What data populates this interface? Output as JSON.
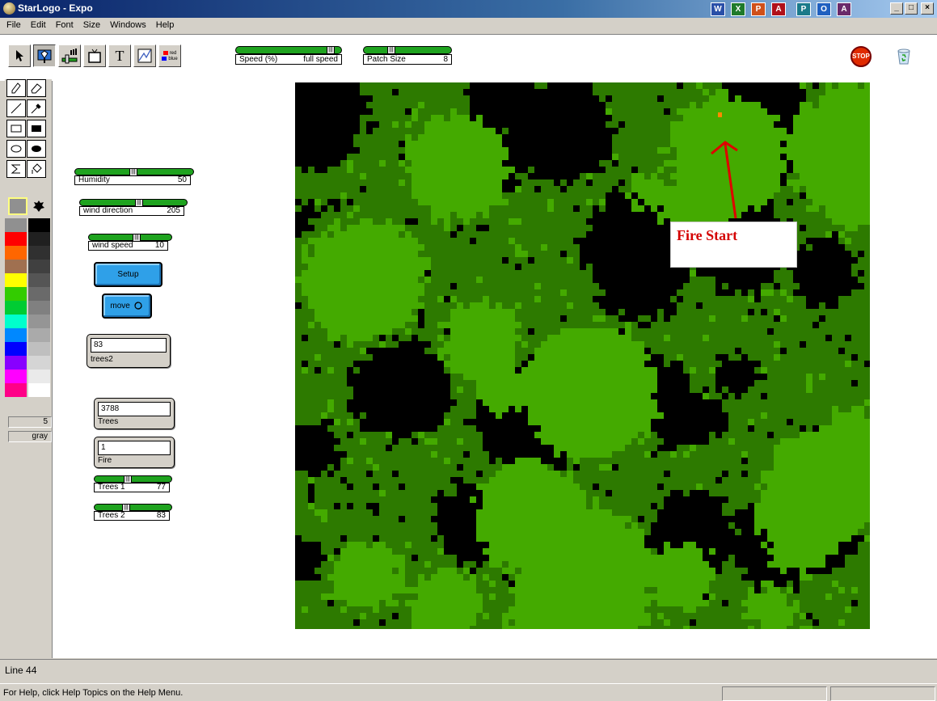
{
  "window": {
    "title": "StarLogo - Expo",
    "tray_icons": [
      "word-icon",
      "excel-icon",
      "powerpoint-icon",
      "acrobat-icon",
      "publisher-icon",
      "outlook-icon",
      "access-icon"
    ],
    "controls": [
      "_",
      "□",
      "×"
    ]
  },
  "menu": {
    "items": [
      "File",
      "Edit",
      "Font",
      "Size",
      "Windows",
      "Help"
    ]
  },
  "toolbar": {
    "buttons": [
      "select-tool-icon",
      "turtle-tool-icon",
      "slider-tool-icon",
      "monitor-tool-icon",
      "text-tool-icon",
      "plot-tool-icon",
      "color-key-tool-icon"
    ],
    "text_tool_label": "T",
    "color_key_labels": [
      "red",
      "blue"
    ],
    "speed": {
      "label": "Speed (%)",
      "value": "full speed",
      "level": 0.95
    },
    "patch_size": {
      "label": "Patch Size",
      "value": "8",
      "level": 0.3
    },
    "stop_label": "STOP"
  },
  "palette": {
    "tools": [
      "pencil-icon",
      "eraser-icon",
      "line-icon",
      "eyedropper-icon",
      "rectangle-outline-icon",
      "rectangle-filled-icon",
      "ellipse-outline-icon",
      "ellipse-filled-icon",
      "sigma-icon",
      "paint-bucket-icon"
    ],
    "colors_left": [
      "#909090",
      "#ff0000",
      "#ff6600",
      "#a07050",
      "#ffff00",
      "#33cc00",
      "#00cc33",
      "#00ffcc",
      "#0088ff",
      "#0000ff",
      "#8800ff",
      "#ff00ff",
      "#ff0088"
    ],
    "colors_right": [
      "#000000",
      "#202020",
      "#303030",
      "#404040",
      "#555555",
      "#6a6a6a",
      "#808080",
      "#959595",
      "#aaaaaa",
      "#bfbfbf",
      "#d5d5d5",
      "#eaeaea",
      "#ffffff"
    ],
    "selected_number": "5",
    "selected_color_name": "gray"
  },
  "sliders": [
    {
      "name": "humidity-slider",
      "label": "Humidity",
      "value": "50",
      "level": 0.5
    },
    {
      "name": "wind-direction-slider",
      "label": "wind direction",
      "value": "205",
      "level": 0.57
    },
    {
      "name": "wind-speed-slider",
      "label": "wind speed",
      "value": "10",
      "level": 0.6
    },
    {
      "name": "trees1-slider",
      "label": "Trees 1",
      "value": "77",
      "level": 0.43
    },
    {
      "name": "trees2-slider",
      "label": "Trees 2",
      "value": "83",
      "level": 0.41
    }
  ],
  "buttons": {
    "setup": "Setup",
    "move": "move"
  },
  "monitors": {
    "trees2": {
      "value": "83",
      "label": "trees2"
    },
    "trees": {
      "value": "3788",
      "label": "Trees"
    },
    "fire": {
      "value": "1",
      "label": "Fire"
    }
  },
  "annotation": {
    "text": "Fire Start",
    "color": "#d40000"
  },
  "world_colors": {
    "bright": "#44aa00",
    "dark": "#2d7a00",
    "empty": "#000000",
    "fire": "#ff8800"
  },
  "status": {
    "line": "Line 44",
    "help": "For Help, click Help Topics on the Help Menu."
  }
}
